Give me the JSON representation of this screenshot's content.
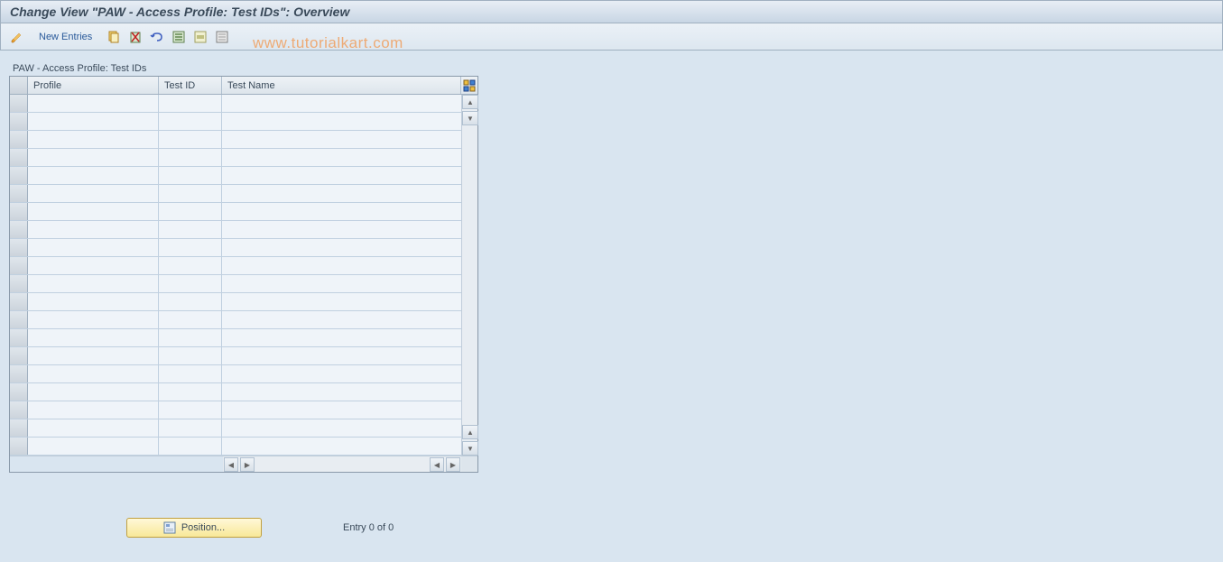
{
  "title": "Change View \"PAW - Access Profile: Test IDs\": Overview",
  "toolbar": {
    "new_entries_label": "New Entries"
  },
  "watermark": "www.tutorialkart.com",
  "group": {
    "title": "PAW - Access Profile: Test IDs"
  },
  "table": {
    "columns": {
      "profile": "Profile",
      "test_id": "Test ID",
      "test_name": "Test Name"
    },
    "row_count": 20
  },
  "footer": {
    "position_label": "Position...",
    "entry_status": "Entry 0 of 0"
  }
}
